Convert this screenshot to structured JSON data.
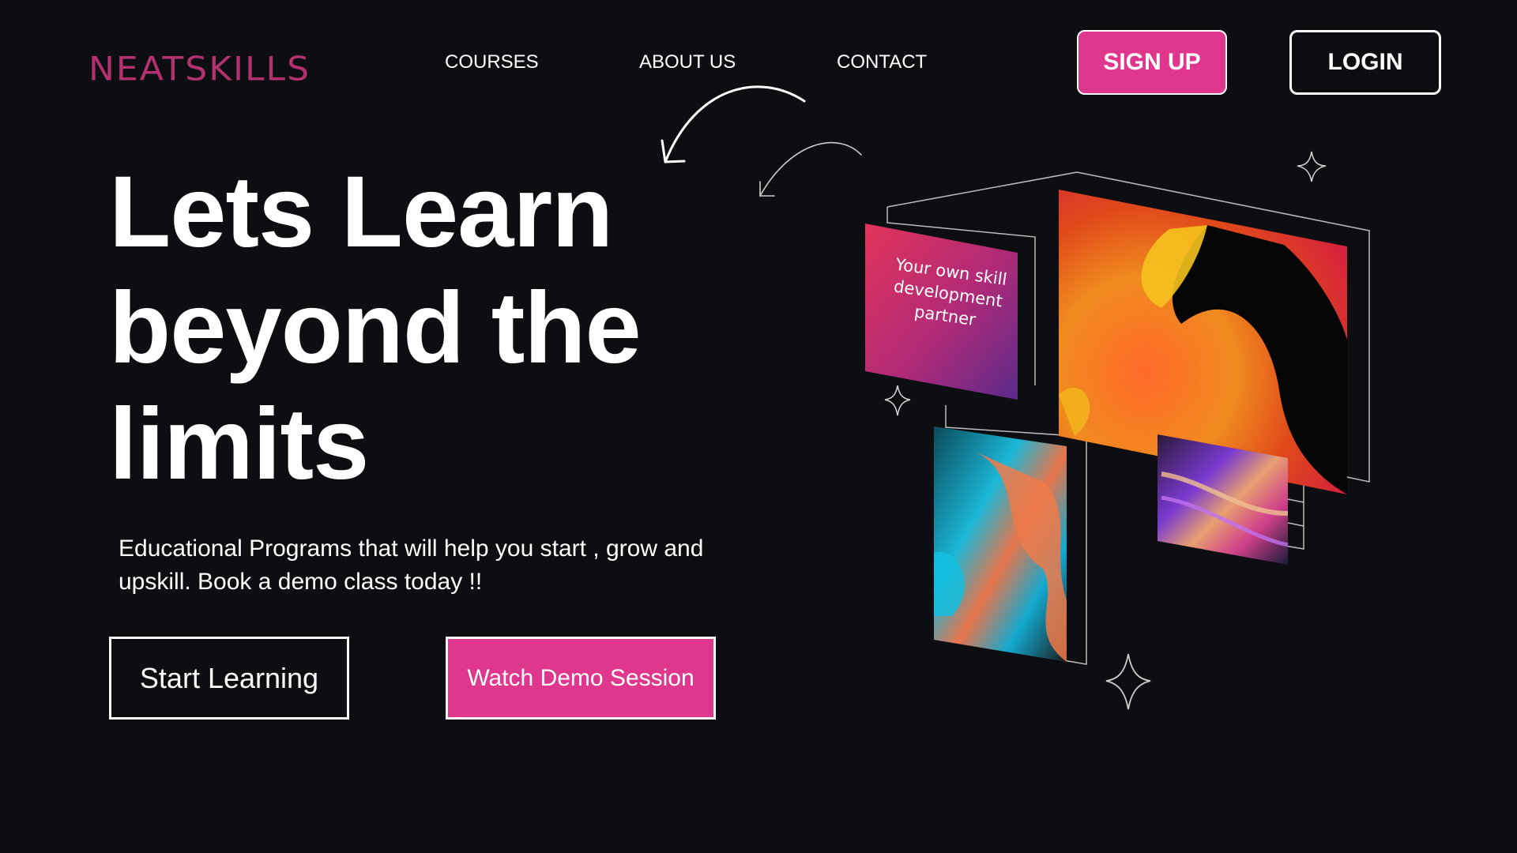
{
  "brand": {
    "logo_text": "NEATSKILLS",
    "logo_color": "#b33170"
  },
  "nav": {
    "items": [
      {
        "label": "COURSES"
      },
      {
        "label": "ABOUT US"
      },
      {
        "label": "CONTACT"
      }
    ]
  },
  "auth": {
    "signup_label": "SIGN UP",
    "login_label": "LOGIN"
  },
  "hero": {
    "title_lines": [
      "Lets Learn",
      "beyond the",
      "limits"
    ],
    "subtitle_line1": "Educational Programs that will help you start , grow and",
    "subtitle_line2": "upskill. Book a demo class today !!",
    "primary_cta": "Start Learning",
    "secondary_cta": "Watch Demo Session"
  },
  "illustration": {
    "card_text": "Your own skill development partner"
  },
  "colors": {
    "background": "#0d0e12",
    "accent_pink": "#e0378e",
    "text": "#ffffff"
  }
}
